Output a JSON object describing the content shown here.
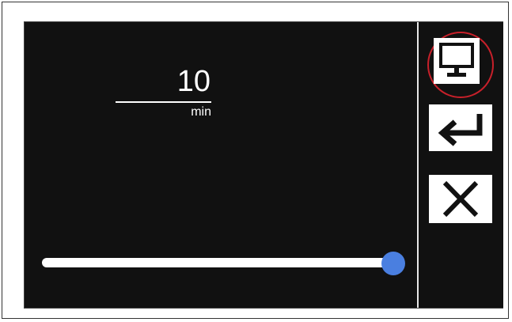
{
  "timer": {
    "value": "10",
    "unit": "min"
  },
  "slider": {
    "level_fraction": 1.0
  },
  "side_panel": {
    "buttons": [
      {
        "icon": "monitor-icon",
        "selected": true
      },
      {
        "icon": "enter-arrow-icon",
        "selected": false
      },
      {
        "icon": "close-icon",
        "selected": false
      }
    ]
  },
  "colors": {
    "screen_background": "#111111",
    "slider_thumb": "#4a7fe0",
    "selection_ring": "#c8202a"
  }
}
